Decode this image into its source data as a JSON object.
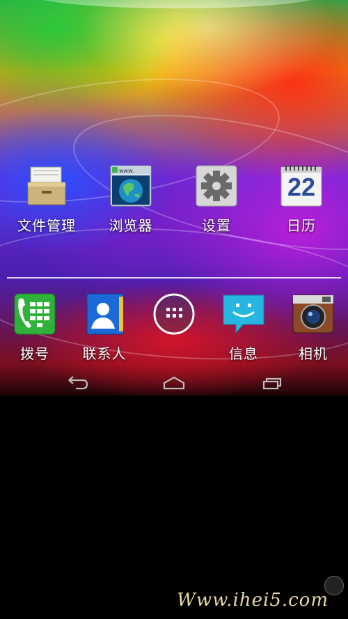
{
  "home": {
    "apps": [
      {
        "label": "文件管理",
        "icon": "file-manager-icon"
      },
      {
        "label": "浏览器",
        "icon": "browser-icon"
      },
      {
        "label": "设置",
        "icon": "settings-gear-icon"
      },
      {
        "label": "日历",
        "icon": "calendar-icon",
        "day": "22"
      }
    ],
    "browser_url": "www."
  },
  "dock": {
    "apps": [
      {
        "label": "拨号",
        "icon": "phone-dialer-icon"
      },
      {
        "label": "联系人",
        "icon": "contacts-icon"
      },
      {
        "label": "",
        "icon": "app-drawer-icon"
      },
      {
        "label": "信息",
        "icon": "messages-icon"
      },
      {
        "label": "相机",
        "icon": "camera-icon"
      }
    ]
  },
  "navbar": {
    "buttons": [
      "back-icon",
      "home-icon",
      "recent-apps-icon"
    ]
  },
  "watermark": {
    "text": "Www.ihei5.com"
  },
  "colors": {
    "calendar_day": "#2a4a9a",
    "phone_green": "#2fb23a",
    "contacts_blue": "#1a6ad8",
    "messages_cyan": "#27b6e0",
    "camera_brown": "#8a4a28"
  }
}
